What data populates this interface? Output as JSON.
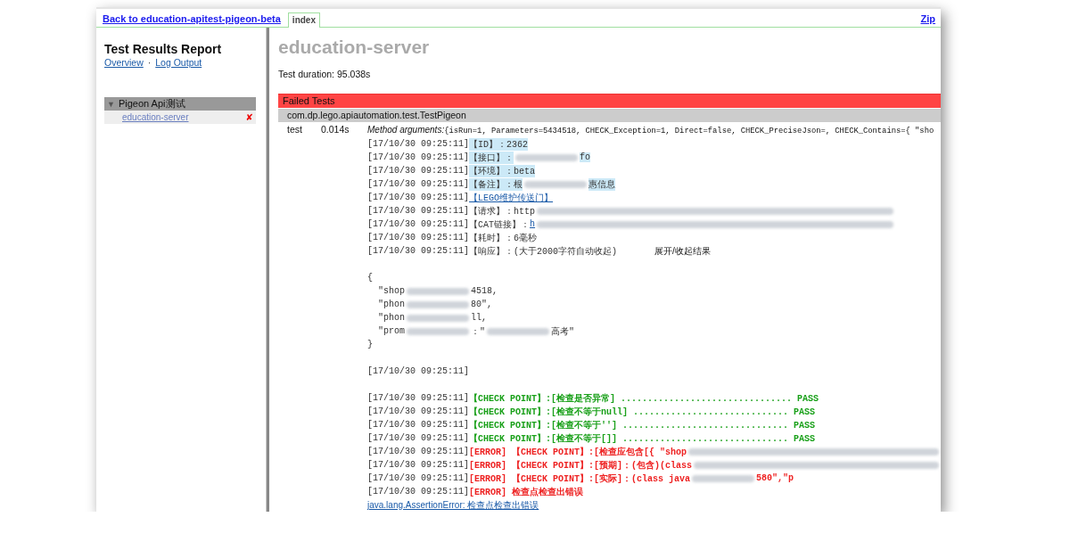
{
  "header": {
    "back_link": "Back to education-apitest-pigeon-beta",
    "tabs": [
      {
        "label": "index",
        "selected": true
      }
    ],
    "zip_link": "Zip"
  },
  "sidebar": {
    "title": "Test Results Report",
    "links": [
      "Overview",
      "Log Output"
    ],
    "separator": "·",
    "tree": [
      {
        "label": "Pigeon Api测试",
        "toggle": "▼",
        "expanded": true,
        "children": [
          {
            "label": "education-server",
            "failed": true,
            "status_mark": "✘"
          }
        ]
      }
    ]
  },
  "main": {
    "title": "education-server",
    "duration": "Test duration: 95.038s",
    "failed_heading": "Failed Tests",
    "class_name": "com.dp.lego.apiautomation.test.TestPigeon",
    "test": {
      "name": "test",
      "time": "0.014s",
      "args_label": "Method arguments:",
      "args": "{isRun=1, Parameters=5434518, CHECK_Exception=1, Direct=false, CHECK_PreciseJson=, CHECK_Contains={ \"sho"
    },
    "log": [
      {
        "parts": [
          {
            "kind": "time",
            "text": "[17/10/30 09:25:11]"
          },
          {
            "kind": "mark",
            "text": "【ID】：2362"
          }
        ]
      },
      {
        "parts": [
          {
            "kind": "time",
            "text": "[17/10/30 09:25:11]"
          },
          {
            "kind": "mark",
            "text": "【接口】："
          },
          {
            "kind": "redacted"
          },
          {
            "kind": "mark",
            "text": "fo"
          }
        ]
      },
      {
        "parts": [
          {
            "kind": "time",
            "text": "[17/10/30 09:25:11]"
          },
          {
            "kind": "mark",
            "text": "【环境】：beta"
          }
        ]
      },
      {
        "parts": [
          {
            "kind": "time",
            "text": "[17/10/30 09:25:11]"
          },
          {
            "kind": "mark",
            "text": "【备注】：根"
          },
          {
            "kind": "redacted"
          },
          {
            "kind": "mark",
            "text": "惠信息"
          }
        ]
      },
      {
        "parts": [
          {
            "kind": "time",
            "text": "[17/10/30 09:25:11]"
          },
          {
            "kind": "link",
            "text": "【LEGO维护传送门】"
          }
        ]
      },
      {
        "parts": [
          {
            "kind": "time",
            "text": "[17/10/30 09:25:11]"
          },
          {
            "kind": "text",
            "text": "【请求】：http"
          },
          {
            "kind": "redacted"
          }
        ]
      },
      {
        "parts": [
          {
            "kind": "time",
            "text": "[17/10/30 09:25:11]"
          },
          {
            "kind": "text",
            "text": "【CAT链接】："
          },
          {
            "kind": "link",
            "text": "h"
          },
          {
            "kind": "redacted"
          }
        ]
      },
      {
        "parts": [
          {
            "kind": "time",
            "text": "[17/10/30 09:25:11]"
          },
          {
            "kind": "text",
            "text": "【耗时】：6毫秒"
          }
        ]
      },
      {
        "parts": [
          {
            "kind": "time",
            "text": "[17/10/30 09:25:11]"
          },
          {
            "kind": "text",
            "text": "【响应】：(大于2000字符自动收起)"
          },
          {
            "kind": "button",
            "text": "展开/收起结果"
          }
        ]
      },
      {
        "kind": "blank"
      },
      {
        "parts": [
          {
            "kind": "text",
            "text": "{"
          }
        ]
      },
      {
        "parts": [
          {
            "kind": "text",
            "text": "  \"shop"
          },
          {
            "kind": "redacted"
          },
          {
            "kind": "text",
            "text": "4518,"
          }
        ]
      },
      {
        "parts": [
          {
            "kind": "text",
            "text": "  \"phon"
          },
          {
            "kind": "redacted"
          },
          {
            "kind": "text",
            "text": "80\","
          }
        ]
      },
      {
        "parts": [
          {
            "kind": "text",
            "text": "  \"phon"
          },
          {
            "kind": "redacted"
          },
          {
            "kind": "text",
            "text": "ll,"
          }
        ]
      },
      {
        "parts": [
          {
            "kind": "text",
            "text": "  \"prom"
          },
          {
            "kind": "redacted"
          },
          {
            "kind": "text",
            "text": "：\""
          },
          {
            "kind": "redacted"
          },
          {
            "kind": "text",
            "text": "高考\""
          }
        ]
      },
      {
        "parts": [
          {
            "kind": "text",
            "text": "}"
          }
        ]
      },
      {
        "kind": "blank"
      },
      {
        "parts": [
          {
            "kind": "time",
            "text": "[17/10/30 09:25:11]"
          }
        ]
      },
      {
        "kind": "blank"
      },
      {
        "parts": [
          {
            "kind": "time",
            "text": "[17/10/30 09:25:11]"
          },
          {
            "kind": "pass",
            "text": "【CHECK POINT】:[检查是否异常] ................................ PASS"
          }
        ]
      },
      {
        "parts": [
          {
            "kind": "time",
            "text": "[17/10/30 09:25:11]"
          },
          {
            "kind": "pass",
            "text": "【CHECK POINT】:[检查不等于null] ............................. PASS"
          }
        ]
      },
      {
        "parts": [
          {
            "kind": "time",
            "text": "[17/10/30 09:25:11]"
          },
          {
            "kind": "pass",
            "text": "【CHECK POINT】:[检查不等于''] ............................... PASS"
          }
        ]
      },
      {
        "parts": [
          {
            "kind": "time",
            "text": "[17/10/30 09:25:11]"
          },
          {
            "kind": "pass",
            "text": "【CHECK POINT】:[检查不等于[]] ............................... PASS"
          }
        ]
      },
      {
        "parts": [
          {
            "kind": "time",
            "text": "[17/10/30 09:25:11]"
          },
          {
            "kind": "error",
            "text": "[ERROR] 【CHECK POINT】:[检查应包含[{ \"shop"
          },
          {
            "kind": "redacted"
          }
        ]
      },
      {
        "parts": [
          {
            "kind": "time",
            "text": "[17/10/30 09:25:11]"
          },
          {
            "kind": "error",
            "text": "[ERROR] 【CHECK POINT】:[预期]：(包含)(class"
          },
          {
            "kind": "redacted"
          }
        ]
      },
      {
        "parts": [
          {
            "kind": "time",
            "text": "[17/10/30 09:25:11]"
          },
          {
            "kind": "error",
            "text": "[ERROR] 【CHECK POINT】:[实际]：(class java"
          },
          {
            "kind": "redacted"
          },
          {
            "kind": "error",
            "text": "580\",\"p"
          }
        ]
      },
      {
        "parts": [
          {
            "kind": "time",
            "text": "[17/10/30 09:25:11]"
          },
          {
            "kind": "error",
            "text": "[ERROR] 检查点检查出错误"
          }
        ]
      }
    ],
    "exception_link": "java.lang.AssertionError: 检查点检查出错误"
  }
}
